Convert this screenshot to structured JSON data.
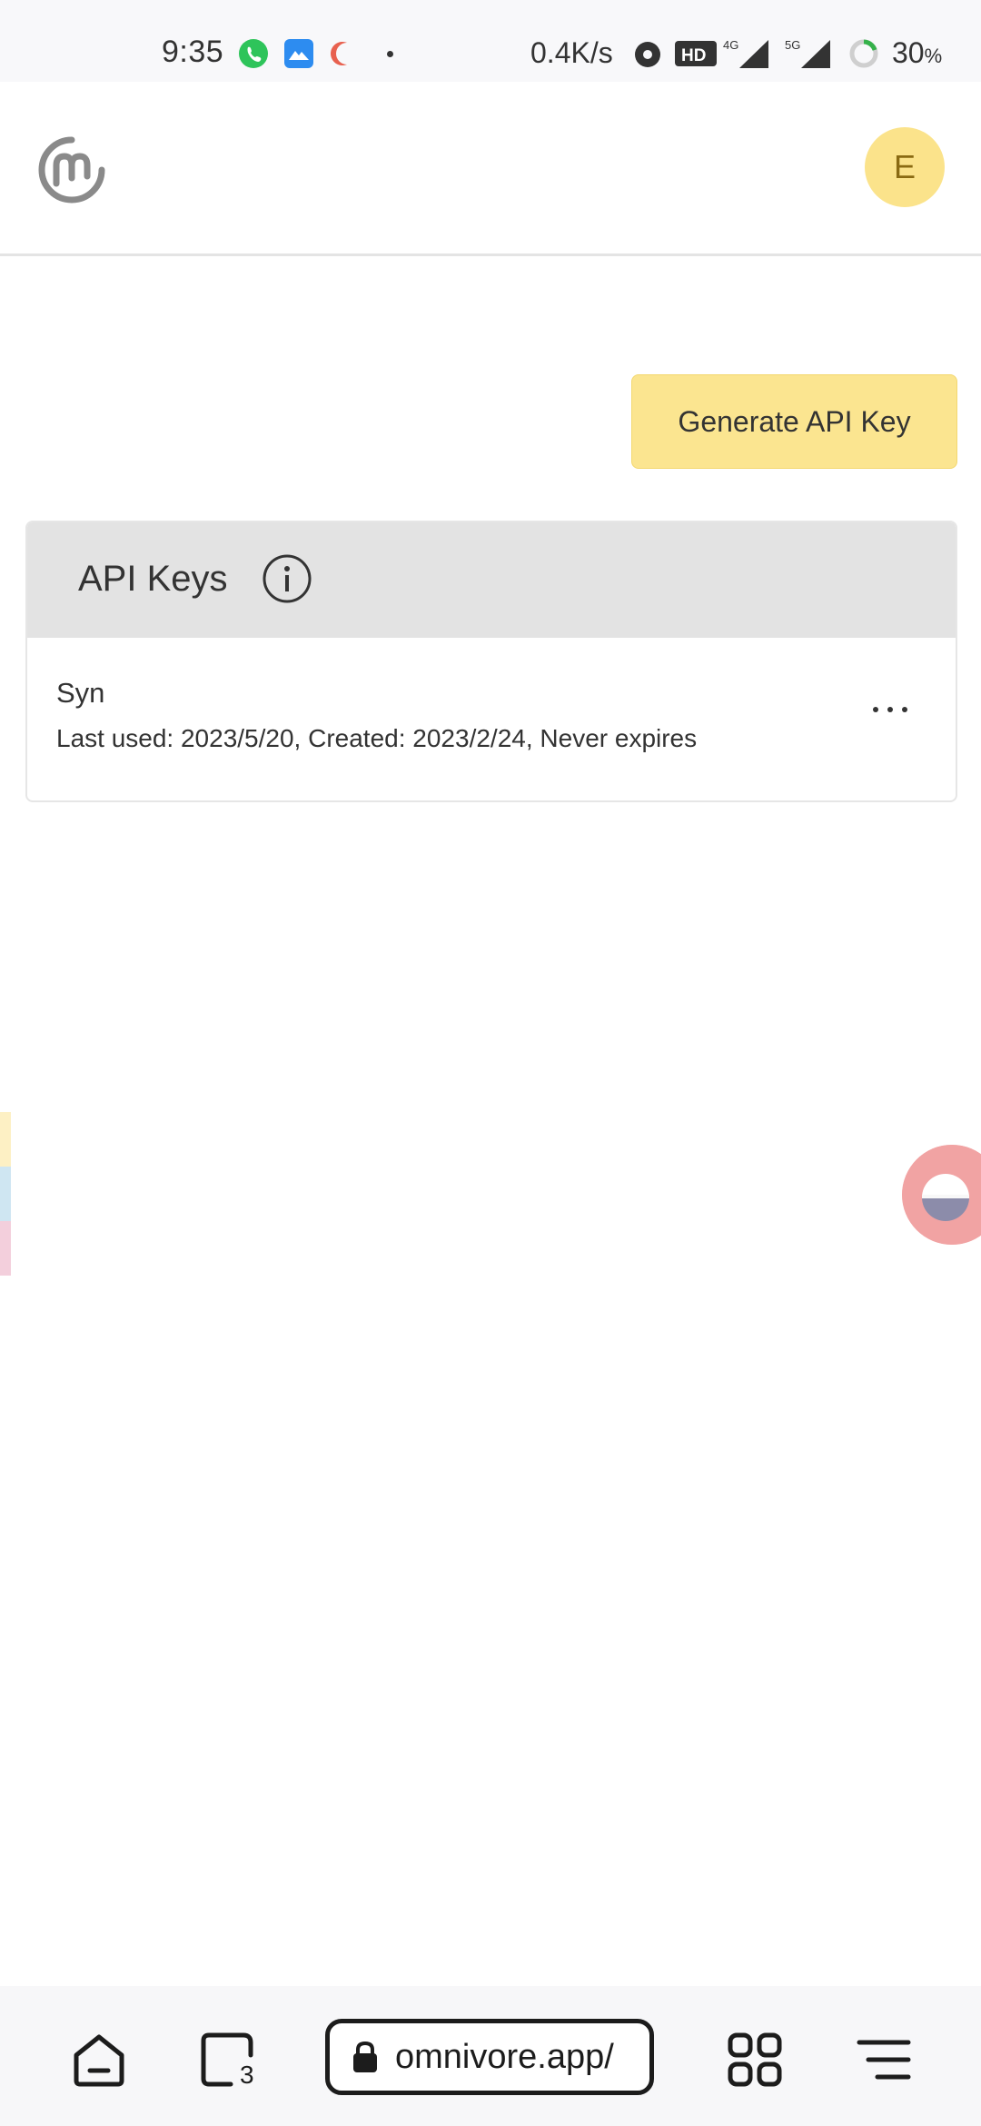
{
  "status_bar": {
    "time": "9:35",
    "network_speed": "0.4K/s",
    "hd_label": "HD",
    "signal_4g": "4G",
    "signal_5g": "5G",
    "battery": "30",
    "battery_unit": "%"
  },
  "header": {
    "avatar_initial": "E"
  },
  "actions": {
    "generate_label": "Generate API Key"
  },
  "api_keys": {
    "title": "API Keys",
    "items": [
      {
        "name": "Syn",
        "meta": "Last used: 2023/5/20, Created: 2023/2/24, Never expires"
      }
    ]
  },
  "browser": {
    "url": "omnivore.app/",
    "tab_count": "3"
  },
  "colors": {
    "accent_yellow": "#fbe590",
    "avatar_bg": "#fbe38b",
    "card_header": "#e3e3e3"
  }
}
